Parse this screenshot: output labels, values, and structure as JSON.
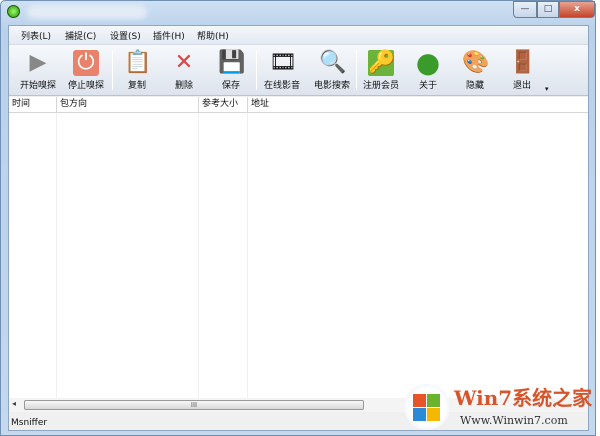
{
  "window": {
    "min": "—",
    "max": "□",
    "close": "x"
  },
  "menu": [
    "列表(L)",
    "捕捉(C)",
    "设置(S)",
    "插件(H)",
    "帮助(H)"
  ],
  "toolbar": [
    {
      "label": "开始嗅探",
      "icon": "start-sniff-icon",
      "glyph": "▶"
    },
    {
      "label": "停止嗅探",
      "icon": "stop-sniff-icon",
      "glyph": "⏻"
    },
    {
      "label": "复制",
      "icon": "copy-icon",
      "glyph": "📋"
    },
    {
      "label": "删除",
      "icon": "delete-icon",
      "glyph": "✕"
    },
    {
      "label": "保存",
      "icon": "save-icon",
      "glyph": "💾"
    },
    {
      "label": "在线影音",
      "icon": "film-icon",
      "glyph": "🎞"
    },
    {
      "label": "电影搜索",
      "icon": "search-icon",
      "glyph": "🔍"
    },
    {
      "label": "注册会员",
      "icon": "key-icon",
      "glyph": "🔑"
    },
    {
      "label": "关于",
      "icon": "about-icon",
      "glyph": "●"
    },
    {
      "label": "隐藏",
      "icon": "hide-icon",
      "glyph": "🎨"
    },
    {
      "label": "退出",
      "icon": "exit-icon",
      "glyph": "🚪"
    }
  ],
  "columns": [
    "时间",
    "包方向",
    "参考大小",
    "地址"
  ],
  "scroll_thumb": "III",
  "status": "Msniffer",
  "watermark": {
    "title": "Win7系统之家",
    "url": "Www.Winwin7.com"
  }
}
